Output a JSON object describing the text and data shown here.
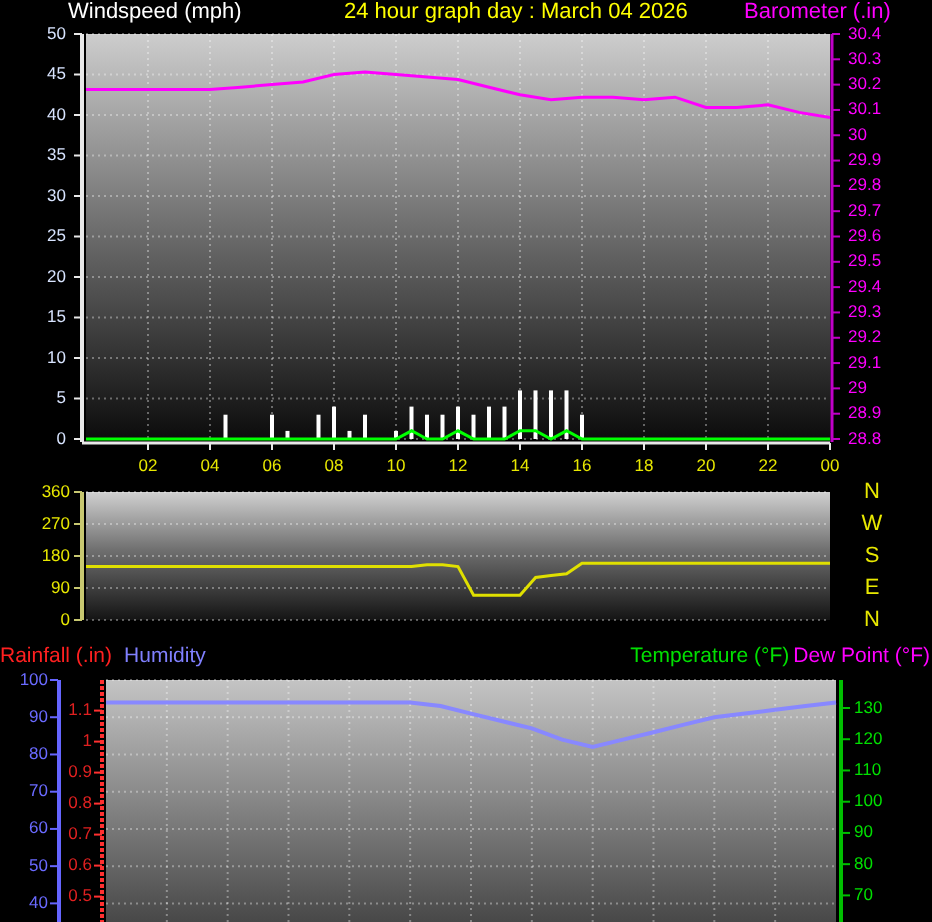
{
  "title": "24 hour graph day : March 04 2026",
  "wind_speed": {
    "chart_data": {
      "type": "bar",
      "ylabel": "Windspeed (mph)",
      "xlim": [
        0,
        24
      ],
      "ylim": [
        0,
        50
      ],
      "xticks": [
        {
          "value": 2,
          "label": "02"
        },
        {
          "value": 4,
          "label": "04"
        },
        {
          "value": 6,
          "label": "06"
        },
        {
          "value": 8,
          "label": "08"
        },
        {
          "value": 10,
          "label": "10"
        },
        {
          "value": 12,
          "label": "12"
        },
        {
          "value": 14,
          "label": "14"
        },
        {
          "value": 16,
          "label": "16"
        },
        {
          "value": 18,
          "label": "18"
        },
        {
          "value": 20,
          "label": "20"
        },
        {
          "value": 22,
          "label": "22"
        }
      ],
      "yticks": [
        0,
        5,
        10,
        15,
        20,
        25,
        30,
        35,
        40,
        45,
        50
      ],
      "x": [
        0,
        0.5,
        1,
        1.5,
        2,
        2.5,
        3,
        3.5,
        4,
        4.5,
        5,
        5.5,
        6,
        6.5,
        7,
        7.5,
        8,
        8.5,
        9,
        9.5,
        10,
        10.5,
        11,
        11.5,
        12,
        12.5,
        13,
        13.5,
        14,
        14.5,
        15,
        15.5,
        16,
        16.5,
        17,
        17.5,
        18,
        18.5,
        19,
        19.5,
        20,
        20.5,
        21,
        21.5,
        22,
        22.5,
        23,
        23.5,
        24
      ],
      "series": [
        {
          "color": "#ffffff",
          "values": [
            0,
            0,
            0,
            0,
            0,
            0,
            0,
            0,
            0,
            3,
            0,
            0,
            3,
            1,
            0,
            3,
            4,
            1,
            3,
            0,
            1,
            4,
            3,
            3,
            4,
            3,
            4,
            4,
            6,
            6,
            6,
            6,
            3,
            0,
            0,
            0,
            0,
            0,
            0,
            0,
            0,
            0,
            0,
            0,
            0,
            0,
            0,
            0,
            0
          ]
        },
        {
          "type": "line",
          "color": "#00ff00",
          "values": [
            0,
            0,
            0,
            0,
            0,
            0,
            0,
            0,
            0,
            0,
            0,
            0,
            0,
            0,
            0,
            0,
            0,
            0,
            0,
            0,
            0,
            1,
            0,
            0,
            1,
            0,
            0,
            0,
            1,
            1,
            0,
            1,
            0,
            0,
            0,
            0,
            0,
            0,
            0,
            0,
            0,
            0,
            0,
            0,
            0,
            0,
            0,
            0,
            0
          ]
        }
      ]
    },
    "x_end_label": "00"
  },
  "barometer": {
    "chart_data": {
      "type": "line",
      "ylabel": "Barometer (.in)",
      "xlim": [
        0,
        24
      ],
      "ylim": [
        28.8,
        30.4
      ],
      "yticks": [
        28.8,
        28.9,
        29,
        29.1,
        29.2,
        29.3,
        29.4,
        29.5,
        29.6,
        29.7,
        29.8,
        29.9,
        30,
        30.1,
        30.2,
        30.3,
        30.4
      ],
      "x": [
        0,
        1,
        2,
        3,
        4,
        5,
        6,
        7,
        8,
        9,
        10,
        11,
        12,
        13,
        14,
        15,
        16,
        17,
        18,
        19,
        20,
        21,
        22,
        23,
        24
      ],
      "series": [
        {
          "color": "#ff00ff",
          "values": [
            30.18,
            30.18,
            30.18,
            30.18,
            30.18,
            30.19,
            30.2,
            30.21,
            30.24,
            30.25,
            30.24,
            30.23,
            30.22,
            30.19,
            30.16,
            30.14,
            30.15,
            30.15,
            30.14,
            30.15,
            30.11,
            30.11,
            30.12,
            30.09,
            30.07
          ]
        }
      ]
    }
  },
  "wind_direction": {
    "chart_data": {
      "type": "line",
      "xlim": [
        0,
        24
      ],
      "ylim": [
        0,
        360
      ],
      "yticks": [
        0,
        90,
        180,
        270,
        360
      ],
      "x": [
        0,
        0.5,
        1,
        1.5,
        2,
        2.5,
        3,
        3.5,
        4,
        4.5,
        5,
        5.5,
        6,
        6.5,
        7,
        7.5,
        8,
        8.5,
        9,
        9.5,
        10,
        10.5,
        11,
        11.5,
        12,
        12.5,
        13,
        13.5,
        14,
        14.5,
        15,
        15.5,
        16,
        16.5,
        17,
        17.5,
        18,
        18.5,
        19,
        19.5,
        20,
        20.5,
        21,
        21.5,
        22,
        22.5,
        23,
        23.5,
        24
      ],
      "series": [
        {
          "color": "#e0e000",
          "values": [
            150,
            150,
            150,
            150,
            150,
            150,
            150,
            150,
            150,
            150,
            150,
            150,
            150,
            150,
            150,
            150,
            150,
            150,
            150,
            150,
            150,
            150,
            155,
            155,
            150,
            70,
            70,
            70,
            70,
            120,
            125,
            130,
            160,
            160,
            160,
            160,
            160,
            160,
            160,
            160,
            160,
            160,
            160,
            160,
            160,
            160,
            160,
            160,
            160
          ]
        }
      ]
    },
    "compass_labels": [
      "N",
      "W",
      "S",
      "E",
      "N"
    ]
  },
  "rainfall_axis": {
    "label": "Rainfall (.in)",
    "ticks": [
      "1.1",
      "1",
      "0.9",
      "0.8",
      "0.7",
      "0.6",
      "0.5"
    ]
  },
  "humidity": {
    "chart_data": {
      "type": "line",
      "ylabel": "Humidity",
      "ylim": [
        35,
        100
      ],
      "yticks": [
        40,
        50,
        60,
        70,
        80,
        90,
        100
      ],
      "categories": [
        null,
        null,
        null,
        null,
        null,
        null,
        null,
        null,
        null,
        null,
        null,
        null,
        null,
        null,
        null,
        null,
        null,
        null,
        null,
        null,
        null,
        null,
        null,
        null,
        null
      ],
      "series": [
        {
          "color": "#8888ff",
          "values": [
            94,
            94,
            94,
            94,
            94,
            94,
            94,
            94,
            94,
            94,
            94,
            93,
            91,
            89,
            87,
            84,
            82,
            84,
            86,
            88,
            90,
            91,
            92,
            93,
            94
          ]
        }
      ]
    }
  },
  "temperature_axis": {
    "label": "Temperature (°F)",
    "ticks": [
      "130",
      "120",
      "110",
      "100",
      "90",
      "80",
      "70"
    ]
  },
  "dew_point": {
    "label": "Dew Point (°F)"
  }
}
